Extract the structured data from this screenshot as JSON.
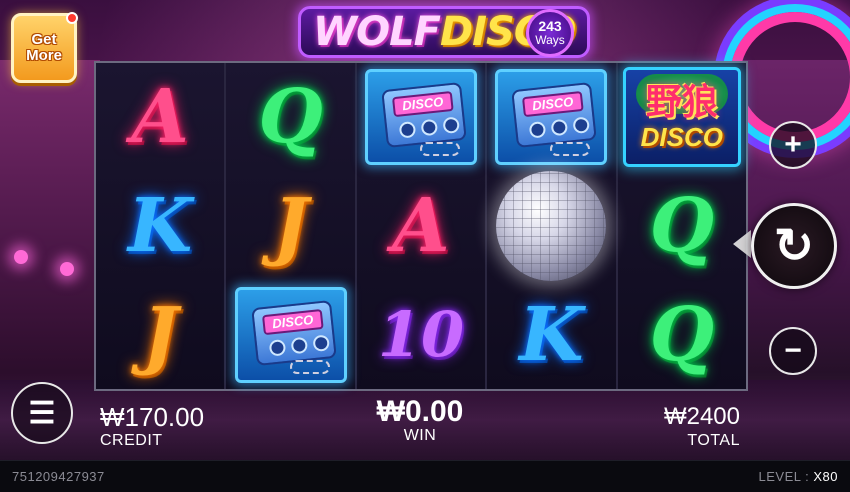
{
  "game": {
    "title_part1": "WOLF",
    "title_part2": "DISCO",
    "ways_number": "243",
    "ways_word": "Ways"
  },
  "get_more": {
    "line1": "Get",
    "line2": "More"
  },
  "reels": [
    [
      {
        "type": "letter",
        "symbol": "A",
        "color": "pink"
      },
      {
        "type": "letter",
        "symbol": "K",
        "color": "blue"
      },
      {
        "type": "letter",
        "symbol": "J",
        "color": "orange"
      }
    ],
    [
      {
        "type": "letter",
        "symbol": "Q",
        "color": "green"
      },
      {
        "type": "letter",
        "symbol": "J",
        "color": "orange"
      },
      {
        "type": "radio",
        "symbol": "DISCO"
      }
    ],
    [
      {
        "type": "radio",
        "symbol": "DISCO"
      },
      {
        "type": "letter",
        "symbol": "A",
        "color": "pink"
      },
      {
        "type": "letter",
        "symbol": "10",
        "color": "purple"
      }
    ],
    [
      {
        "type": "radio",
        "symbol": "DISCO"
      },
      {
        "type": "discoball"
      },
      {
        "type": "letter",
        "symbol": "K",
        "color": "blue"
      }
    ],
    [
      {
        "type": "wild",
        "chinese": "野狼",
        "english": "DISCO"
      },
      {
        "type": "letter",
        "symbol": "Q",
        "color": "green"
      },
      {
        "type": "letter",
        "symbol": "Q",
        "color": "green"
      }
    ]
  ],
  "controls": {
    "plus_icon": "+",
    "minus_icon": "−",
    "spin_icon": "↻",
    "menu_icon": "☰"
  },
  "stats": {
    "credit_value": "₩170.00",
    "credit_label": "CREDIT",
    "win_value": "₩0.00",
    "win_label": "WIN",
    "total_value": "₩2400",
    "total_label": "TOTAL"
  },
  "footer": {
    "session_id": "751209427937",
    "level_label": "LEVEL : ",
    "level_value": "X80"
  },
  "colors": {
    "pink": "#ff4f8c",
    "green": "#3df07a",
    "blue": "#38b6ff",
    "orange": "#ffaa2c",
    "purple": "#c86bff"
  }
}
